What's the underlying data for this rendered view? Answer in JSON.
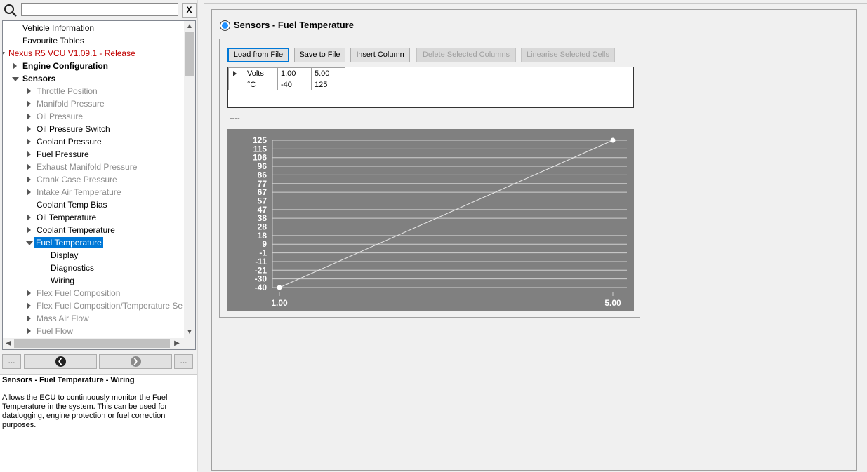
{
  "search": {
    "value": "",
    "clear_label": "X"
  },
  "tree": [
    {
      "label": "Vehicle Information",
      "level": 1,
      "arrow": "none",
      "style": ""
    },
    {
      "label": "Favourite Tables",
      "level": 1,
      "arrow": "none",
      "style": ""
    },
    {
      "label": "Nexus R5 VCU V1.09.1 - Release",
      "level": 0,
      "arrow": "down",
      "style": "red"
    },
    {
      "label": "Engine Configuration",
      "level": 1,
      "arrow": "right",
      "style": "bold"
    },
    {
      "label": "Sensors",
      "level": 1,
      "arrow": "down",
      "style": "bold"
    },
    {
      "label": "Throttle Position",
      "level": 2,
      "arrow": "right",
      "style": "grey"
    },
    {
      "label": "Manifold Pressure",
      "level": 2,
      "arrow": "right",
      "style": "grey"
    },
    {
      "label": "Oil Pressure",
      "level": 2,
      "arrow": "right",
      "style": "grey"
    },
    {
      "label": "Oil Pressure Switch",
      "level": 2,
      "arrow": "right",
      "style": ""
    },
    {
      "label": "Coolant Pressure",
      "level": 2,
      "arrow": "right",
      "style": ""
    },
    {
      "label": "Fuel Pressure",
      "level": 2,
      "arrow": "right",
      "style": ""
    },
    {
      "label": "Exhaust Manifold Pressure",
      "level": 2,
      "arrow": "right",
      "style": "grey"
    },
    {
      "label": "Crank Case Pressure",
      "level": 2,
      "arrow": "right",
      "style": "grey"
    },
    {
      "label": "Intake Air Temperature",
      "level": 2,
      "arrow": "right",
      "style": "grey"
    },
    {
      "label": "Coolant Temp Bias",
      "level": 2,
      "arrow": "none",
      "style": ""
    },
    {
      "label": "Oil Temperature",
      "level": 2,
      "arrow": "right",
      "style": ""
    },
    {
      "label": "Coolant Temperature",
      "level": 2,
      "arrow": "right",
      "style": ""
    },
    {
      "label": "Fuel Temperature",
      "level": 2,
      "arrow": "down",
      "style": "selected"
    },
    {
      "label": "Display",
      "level": 3,
      "arrow": "none",
      "style": ""
    },
    {
      "label": "Diagnostics",
      "level": 3,
      "arrow": "none",
      "style": ""
    },
    {
      "label": "Wiring",
      "level": 3,
      "arrow": "none",
      "style": ""
    },
    {
      "label": "Flex Fuel Composition",
      "level": 2,
      "arrow": "right",
      "style": "grey"
    },
    {
      "label": "Flex Fuel Composition/Temperature Se",
      "level": 2,
      "arrow": "right",
      "style": "grey"
    },
    {
      "label": "Mass Air Flow",
      "level": 2,
      "arrow": "right",
      "style": "grey"
    },
    {
      "label": "Fuel Flow",
      "level": 2,
      "arrow": "right",
      "style": "grey"
    }
  ],
  "nav": {
    "more_left": "...",
    "more_right": "..."
  },
  "description": {
    "title": "Sensors - Fuel Temperature - Wiring",
    "text": "Allows the ECU to continuously monitor the Fuel Temperature in the system. This can be used for datalogging, engine protection or fuel correction purposes."
  },
  "section": {
    "title": "Sensors - Fuel Temperature"
  },
  "toolbar": {
    "load_label": "Load from File",
    "save_label": "Save to File",
    "insert_label": "Insert Column",
    "delete_label": "Delete Selected Columns",
    "linearise_label": "Linearise Selected Cells"
  },
  "grid": {
    "rows": [
      {
        "header": "Volts",
        "values": [
          "1.00",
          "5.00"
        ]
      },
      {
        "header": "°C",
        "values": [
          "-40",
          "125"
        ]
      }
    ]
  },
  "status_text": "----",
  "chart_data": {
    "type": "line",
    "x": [
      1.0,
      5.0
    ],
    "x_tick_labels": [
      "1.00",
      "5.00"
    ],
    "series": [
      {
        "values": [
          -40,
          125
        ]
      }
    ],
    "y_tick_labels": [
      "125",
      "115",
      "106",
      "96",
      "86",
      "77",
      "67",
      "57",
      "47",
      "38",
      "28",
      "18",
      "9",
      "-1",
      "-11",
      "-21",
      "-30",
      "-40"
    ],
    "ylim": [
      -40,
      125
    ],
    "xlim": [
      1.0,
      5.0
    ],
    "grid": true,
    "colors": {
      "background": "#808080",
      "grid": "#d0d0d0",
      "line": "#e8e8e8",
      "point": "#ffffff",
      "text": "#ffffff"
    }
  }
}
